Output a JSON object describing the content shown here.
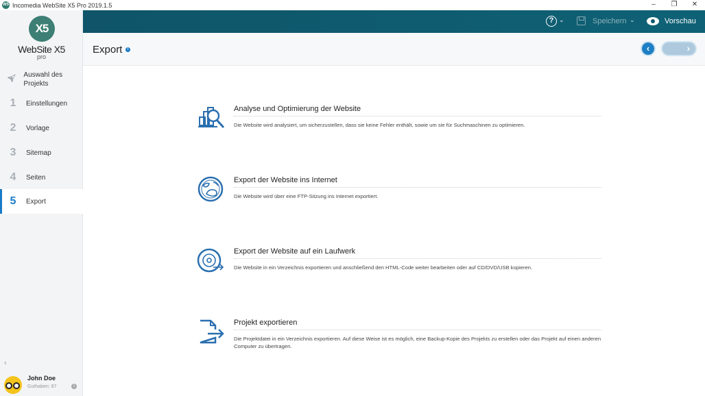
{
  "window": {
    "title": "Incomedia WebSite X5 Pro 2019.1.5",
    "app_icon": "websitex5-app-icon",
    "controls": [
      "minimize",
      "restore",
      "close"
    ]
  },
  "logo": {
    "mark": "X5",
    "name": "WebSite X5",
    "edition": "pro"
  },
  "sidebar": {
    "items": [
      {
        "num": "",
        "icon": "rocket-icon",
        "label": "Auswahl des Projekts"
      },
      {
        "num": "1",
        "label": "Einstellungen"
      },
      {
        "num": "2",
        "label": "Vorlage"
      },
      {
        "num": "3",
        "label": "Sitemap"
      },
      {
        "num": "4",
        "label": "Seiten"
      },
      {
        "num": "5",
        "label": "Export",
        "active": true
      }
    ],
    "collapse": "‹",
    "user": {
      "name": "John Doe",
      "credit": "Guthaben: 87"
    }
  },
  "toolbar": {
    "help": "?",
    "save_label": "Speichern",
    "preview_label": "Vorschau"
  },
  "header": {
    "title": "Export",
    "info": "i",
    "back": "‹",
    "next": "›"
  },
  "options": [
    {
      "title": "Analyse und Optimierung der Website",
      "desc": "Die Website wird analysiert, um sicherzustellen, dass sie keine Fehler enthält, sowie um sie für Suchmaschinen zu optimieren.",
      "icon": "analysis-icon"
    },
    {
      "title": "Export der Website ins Internet",
      "desc": "Die Website wird über eine FTP-Sitzung ins Internet exportiert.",
      "icon": "globe-icon"
    },
    {
      "title": "Export der Website auf ein Laufwerk",
      "desc": "Die Website in ein Verzeichnis exportieren und  anschließend den HTML-Code weiter bearbeiten oder auf CD/DVD/USB kopieren.",
      "icon": "disc-icon"
    },
    {
      "title": "Projekt exportieren",
      "desc": "Die Projektdatei in ein Verzeichnis exportieren. Auf diese Weise ist es möglich, eine Backup-Kopie des Projekts zu erstellen oder das Projekt auf einen anderen Computer zu übertragen.",
      "icon": "file-export-icon"
    }
  ],
  "colors": {
    "accent": "#1a7ac6",
    "topbar": "#0f5a6e",
    "icon": "#2a6fb0"
  }
}
